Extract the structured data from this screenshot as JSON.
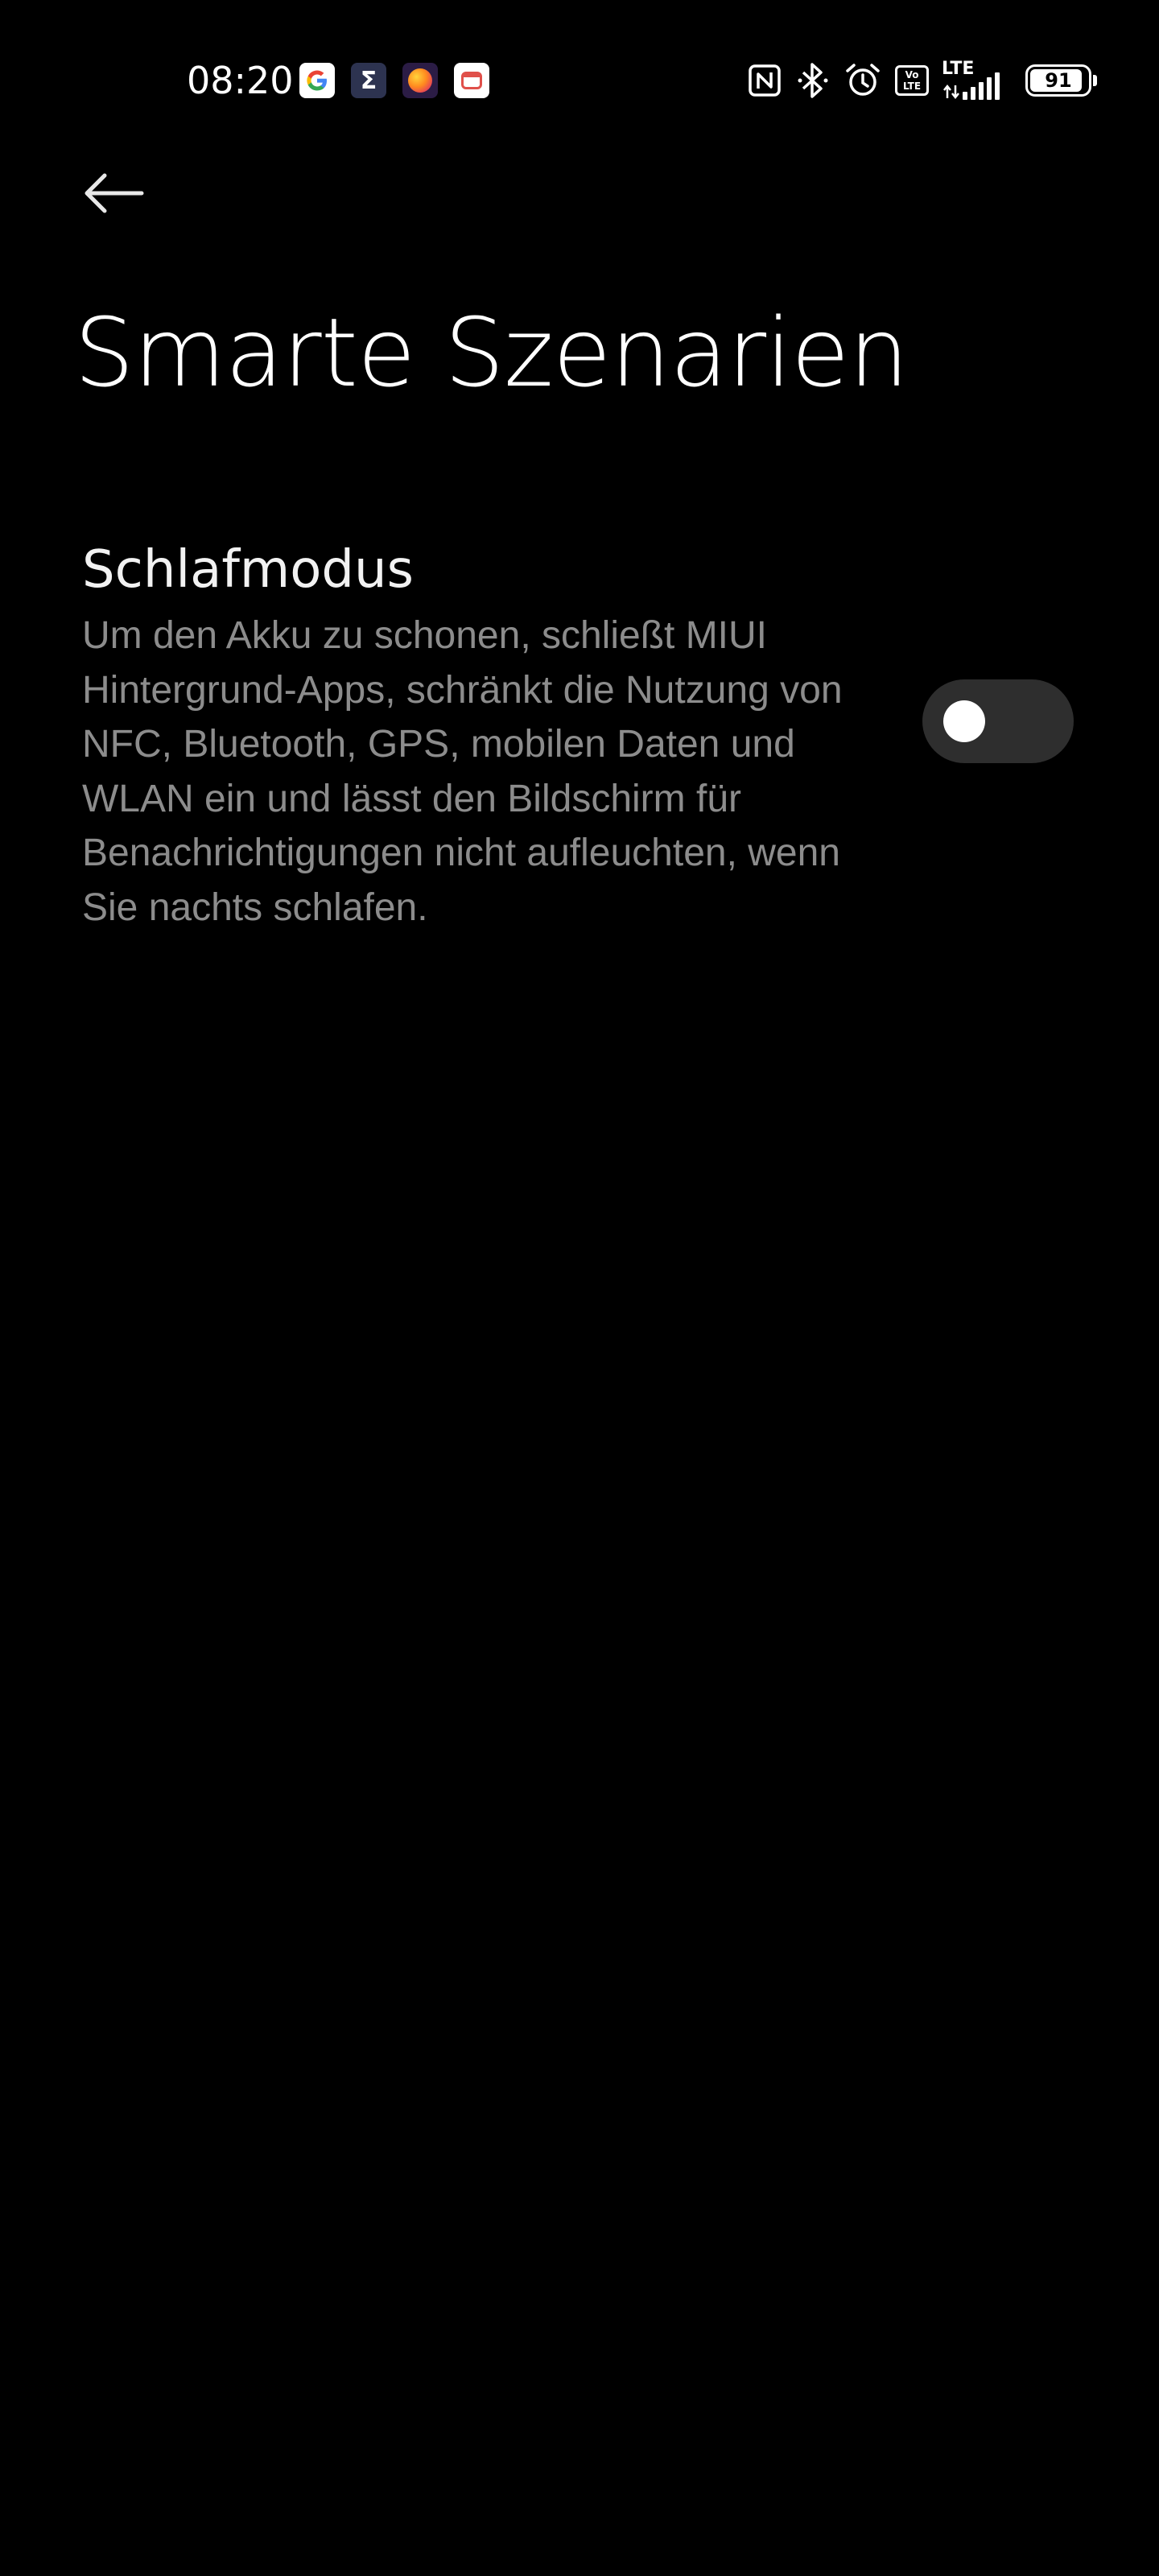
{
  "status_bar": {
    "time": "08:20",
    "notification_icons": [
      "google-icon",
      "sigma-icon",
      "firefox-icon",
      "alarm-app-icon"
    ],
    "system_icons": [
      "nfc-icon",
      "bluetooth-icon",
      "alarm-icon",
      "volte-icon",
      "lte-signal-icon"
    ],
    "volte_label": "Vo\nLTE",
    "network_type": "LTE",
    "battery_level": "91"
  },
  "header": {
    "back_icon": "arrow-left-icon",
    "title": "Smarte Szenarien"
  },
  "settings": {
    "sleep_mode": {
      "title": "Schlafmodus",
      "description": "Um den Akku zu schonen, schließt MIUI Hintergrund-Apps, schränkt die Nutzung von NFC, Bluetooth, GPS, mobilen Daten und WLAN ein und lässt den Bildschirm für Benachrichtigungen nicht aufleuchten, wenn Sie nachts schlafen.",
      "enabled": false
    }
  },
  "colors": {
    "background": "#000000",
    "title_text": "#ffffff",
    "description_text": "#8c8c8c",
    "toggle_off_track": "#2e2e2e",
    "toggle_knob": "#ffffff"
  }
}
